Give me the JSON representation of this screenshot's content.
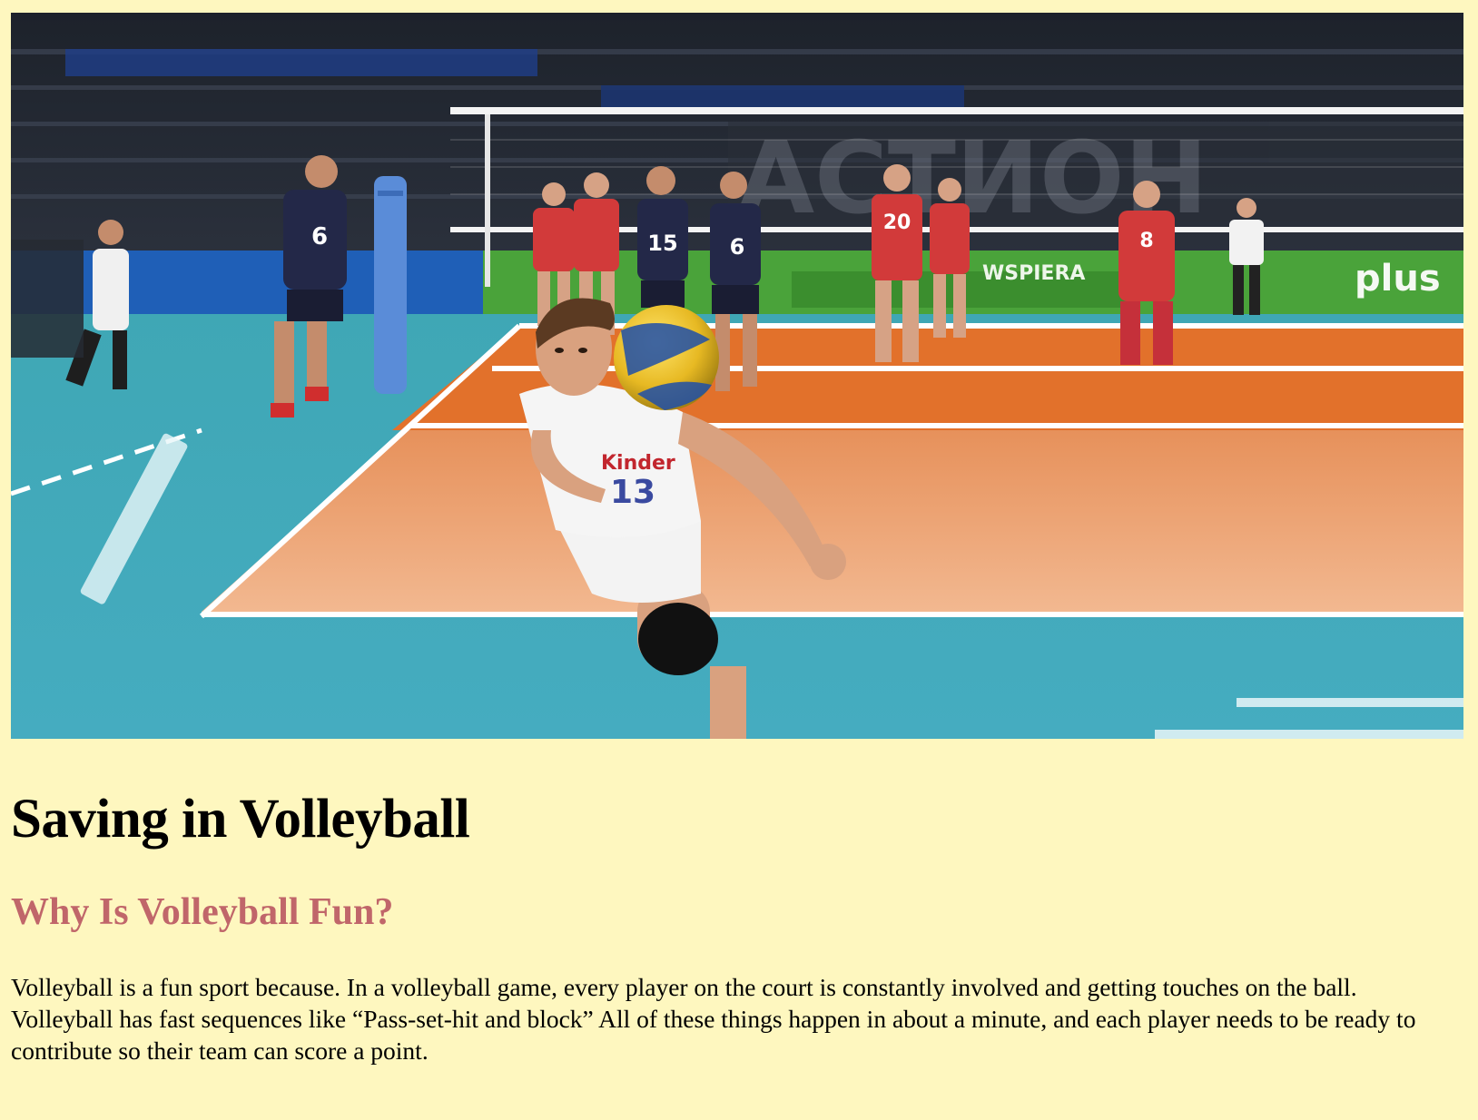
{
  "hero": {
    "alt": "Volleyball player diving to save the ball",
    "banner_text": "WSPIERA",
    "sponsor_text": "plus",
    "player_numbers": [
      "6",
      "15",
      "6",
      "20",
      "8",
      "13"
    ]
  },
  "article": {
    "title": "Saving in Volleyball",
    "subtitle": "Why Is Volleyball Fun?",
    "body": "Volleyball is a fun sport because. In a volleyball game, every player on the court is constantly involved and getting touches on the ball. Volleyball has fast sequences like “Pass-set-hit and block” All of these things happen in about a minute, and each player needs to be ready to contribute so their team can score a point."
  },
  "colors": {
    "page_background": "#fef7bf",
    "subtitle": "#c0666a"
  }
}
